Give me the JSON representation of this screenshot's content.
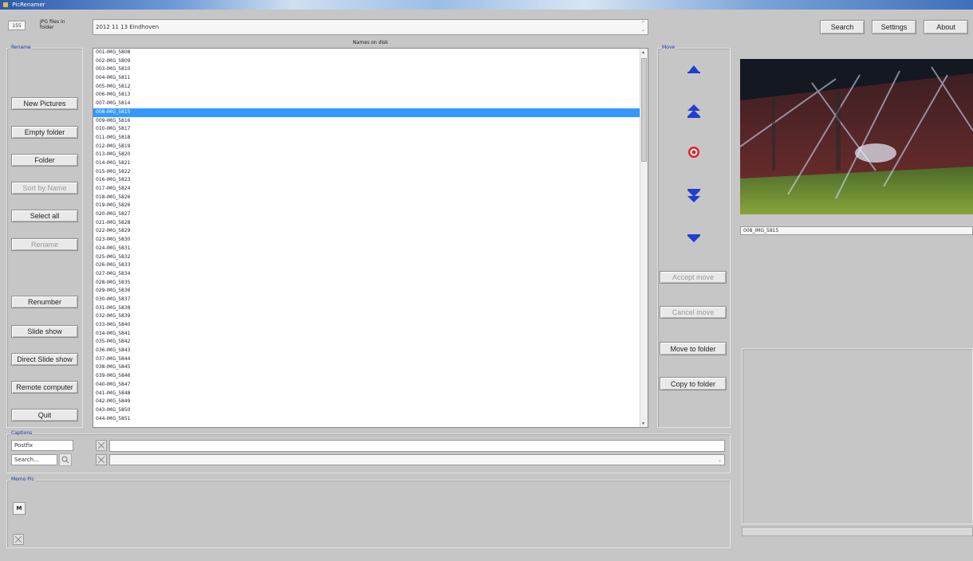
{
  "window": {
    "title": "PicRenamer"
  },
  "header": {
    "count": "155",
    "jpg_label": "JPG files in folder",
    "folder_path": "2012 11 13 Eindhoven",
    "search_label": "Search",
    "settings_label": "Settings",
    "about_label": "About"
  },
  "rename_panel": {
    "title": "Rename",
    "buttons": [
      {
        "label": "New Pictures",
        "enabled": true
      },
      {
        "label": "Empty folder",
        "enabled": true
      },
      {
        "label": "Folder",
        "enabled": true
      },
      {
        "label": "Sort by Name",
        "enabled": false
      },
      {
        "label": "Select all",
        "enabled": true
      },
      {
        "label": "Rename",
        "enabled": false
      },
      {
        "label": "Renumber",
        "enabled": true
      },
      {
        "label": "Slide show",
        "enabled": true
      },
      {
        "label": "Direct Slide show",
        "enabled": true
      },
      {
        "label": "Remote computer",
        "enabled": true
      },
      {
        "label": "Quit",
        "enabled": true
      }
    ]
  },
  "file_list": {
    "header": "Names on disk",
    "selected_index": 7,
    "items": [
      "001-IMG_5808",
      "002-IMG_5809",
      "003-IMG_5810",
      "004-IMG_5811",
      "005-IMG_5812",
      "006-IMG_5813",
      "007-IMG_5814",
      "008-IMG_5815",
      "009-IMG_5816",
      "010-IMG_5817",
      "011-IMG_5818",
      "012-IMG_5819",
      "013-IMG_5820",
      "014-IMG_5821",
      "015-IMG_5822",
      "016-IMG_5823",
      "017-IMG_5824",
      "018-IMG_5826",
      "019-IMG_5826",
      "020-IMG_5827",
      "021-IMG_5828",
      "022-IMG_5829",
      "023-IMG_5830",
      "024-IMG_5831",
      "025-IMG_5832",
      "026-IMG_5833",
      "027-IMG_5834",
      "028-IMG_5835",
      "029-IMG_5836",
      "030-IMG_5837",
      "031-IMG_5838",
      "032-IMG_5839",
      "033-IMG_5840",
      "034-IMG_5841",
      "035-IMG_5842",
      "036-IMG_5843",
      "037-IMG_5844",
      "038-IMG_5845",
      "039-IMG_5846",
      "040-IMG_5847",
      "041-IMG_5848",
      "042-IMG_5849",
      "043-IMG_5850",
      "044-IMG_5851"
    ]
  },
  "move_panel": {
    "title": "Move",
    "accept_label": "Accept move",
    "cancel_label": "Cancel move",
    "move_to_folder_label": "Move to folder",
    "copy_to_folder_label": "Copy to folder"
  },
  "preview": {
    "filename": "008_IMG_5815"
  },
  "captions": {
    "title": "Captions",
    "prefix_value": "Postfix",
    "search_placeholder": "Search...",
    "caption_value": "",
    "caption2_value": ""
  },
  "memo": {
    "title": "Memo Pic",
    "m_label": "M"
  },
  "colors": {
    "selection": "#3399ff",
    "group_title": "#1a3fb0",
    "arrow_blue": "#1f3fd1",
    "target_red": "#e0202a"
  }
}
